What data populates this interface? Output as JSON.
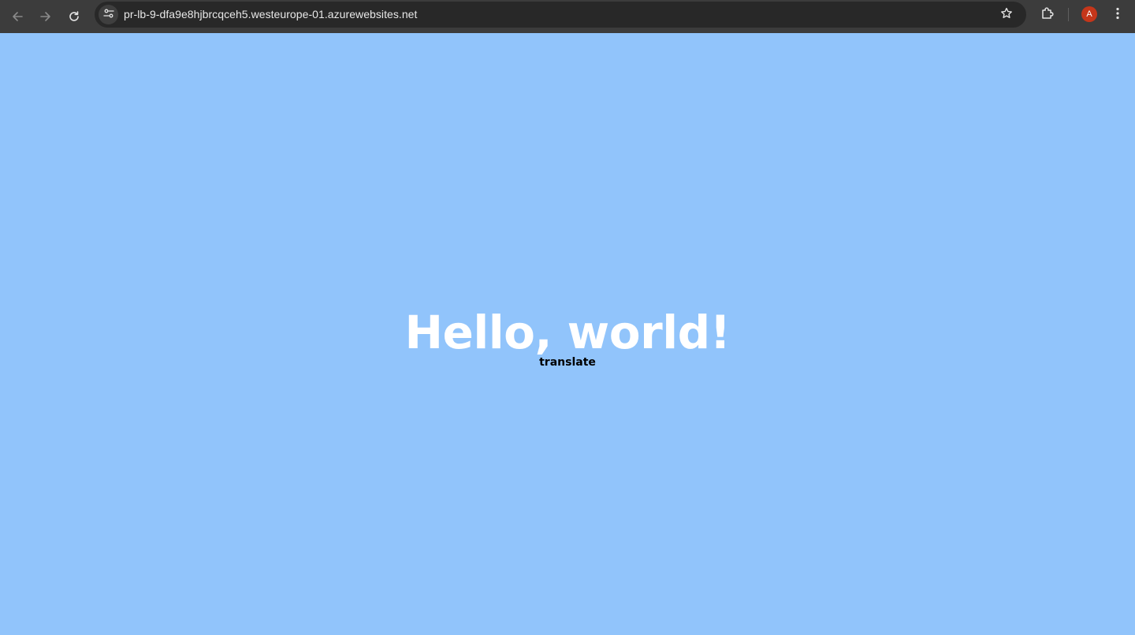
{
  "browser": {
    "url": "pr-lb-9-dfa9e8hjbrcqceh5.westeurope-01.azurewebsites.net",
    "profile_initial": "A",
    "icons": {
      "back": "arrow-left-icon",
      "forward": "arrow-right-icon",
      "reload": "reload-icon",
      "site_info": "tune-icon",
      "bookmark": "star-icon",
      "extensions": "puzzle-icon",
      "menu": "kebab-menu-icon"
    },
    "colors": {
      "toolbar": "#3c3c3c",
      "omnibox": "#282828",
      "avatar": "#c5361a"
    }
  },
  "page": {
    "heading": "Hello, world!",
    "link": "translate",
    "colors": {
      "background": "#91c4fb",
      "heading": "#ffffff",
      "link": "#000000"
    }
  }
}
